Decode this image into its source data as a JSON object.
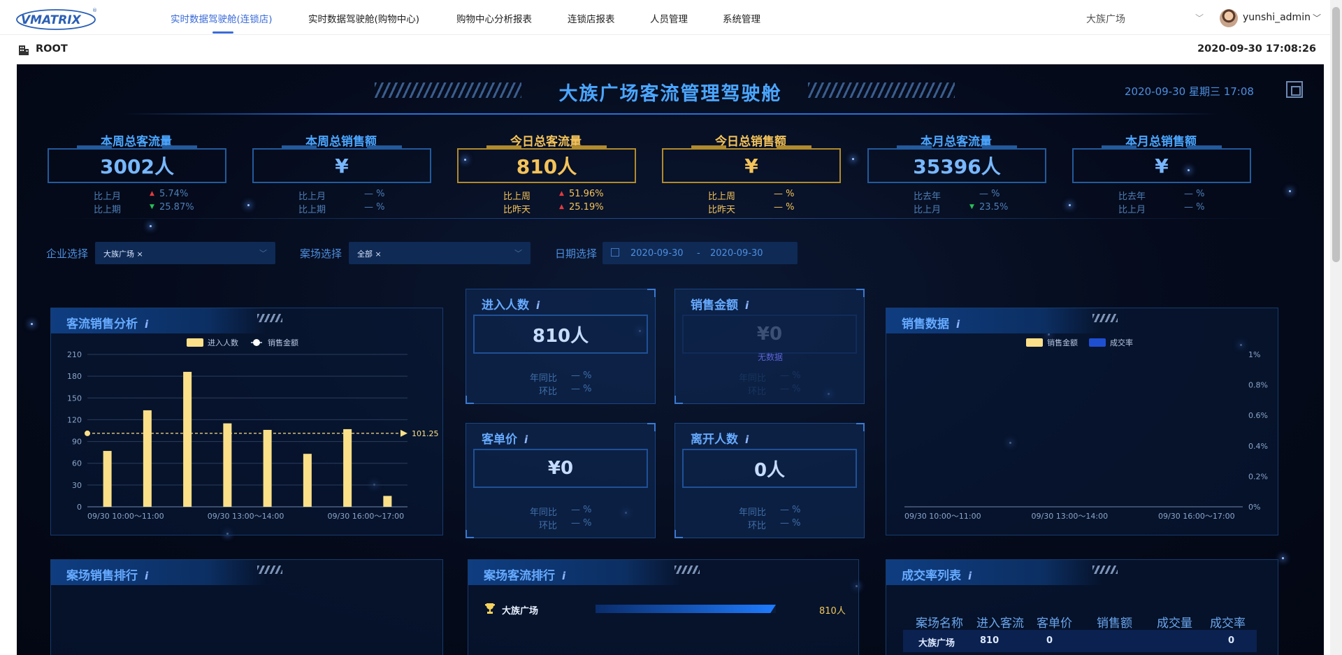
{
  "brand": {
    "logo_text": "VMATRIX",
    "registered_mark": "®"
  },
  "nav": {
    "items": [
      {
        "label": "实时数据驾驶舱(连锁店)",
        "active": true
      },
      {
        "label": "实时数据驾驶舱(购物中心)",
        "active": false
      },
      {
        "label": "购物中心分析报表",
        "active": false
      },
      {
        "label": "连锁店报表",
        "active": false
      },
      {
        "label": "人员管理",
        "active": false
      },
      {
        "label": "系统管理",
        "active": false
      }
    ],
    "store_select": "大族广场",
    "user_name": "yunshi_admin",
    "accent_color": "#3a6bd8"
  },
  "breadcrumb": {
    "root": "ROOT",
    "datetime": "2020-09-30 17:08:26"
  },
  "dashboard": {
    "title": "大族广场客流管理驾驶舱",
    "date_text": "2020-09-30 星期三 17:08",
    "kpis": [
      {
        "title": "本周总客流量",
        "value": "3002人",
        "theme": "blue",
        "rows": [
          {
            "label": "比上月",
            "arrow": "up",
            "value": "5.74%"
          },
          {
            "label": "比上期",
            "arrow": "down",
            "value": "25.87%"
          }
        ]
      },
      {
        "title": "本周总销售额",
        "value": "¥",
        "theme": "blue",
        "rows": [
          {
            "label": "比上月",
            "arrow": "none",
            "value": "— %"
          },
          {
            "label": "比上期",
            "arrow": "none",
            "value": "— %"
          }
        ]
      },
      {
        "title": "今日总客流量",
        "value": "810人",
        "theme": "gold",
        "rows": [
          {
            "label": "比上周",
            "arrow": "up",
            "value": "51.96%"
          },
          {
            "label": "比昨天",
            "arrow": "up",
            "value": "25.19%"
          }
        ]
      },
      {
        "title": "今日总销售额",
        "value": "¥",
        "theme": "gold",
        "rows": [
          {
            "label": "比上周",
            "arrow": "none",
            "value": "— %"
          },
          {
            "label": "比昨天",
            "arrow": "none",
            "value": "— %"
          }
        ]
      },
      {
        "title": "本月总客流量",
        "value": "35396人",
        "theme": "blue",
        "rows": [
          {
            "label": "比去年",
            "arrow": "none",
            "value": "— %"
          },
          {
            "label": "比上月",
            "arrow": "down",
            "value": "23.5%"
          }
        ]
      },
      {
        "title": "本月总销售额",
        "value": "¥",
        "theme": "blue",
        "rows": [
          {
            "label": "比去年",
            "arrow": "none",
            "value": "— %"
          },
          {
            "label": "比上月",
            "arrow": "none",
            "value": "— %"
          }
        ]
      }
    ],
    "arrows": {
      "up": "▲",
      "down": "▼"
    },
    "filters": {
      "enterprise_label": "企业选择",
      "enterprise_tag": "大族广场 ×",
      "venue_label": "案场选择",
      "venue_tag": "全部 ×",
      "date_label": "日期选择",
      "date_start": "2020-09-30",
      "date_sep": "-",
      "date_end": "2020-09-30"
    },
    "traffic_sales_panel": {
      "title": "客流销售分析",
      "legend_traffic": "进入人数",
      "legend_sales": "销售金额"
    },
    "entries_card": {
      "title": "进入人数",
      "value": "810人",
      "yoy_label": "年同比",
      "yoy": "— %",
      "mom_label": "环比",
      "mom": "— %"
    },
    "sales_card": {
      "title": "销售金额",
      "value": "¥0",
      "nodata": "无数据",
      "yoy_label": "年同比",
      "yoy": "— %",
      "mom_label": "环比",
      "mom": "— %"
    },
    "unit_price_card": {
      "title": "客单价",
      "value": "¥0",
      "yoy_label": "年同比",
      "yoy": "— %",
      "mom_label": "环比",
      "mom": "— %"
    },
    "exits_card": {
      "title": "离开人数",
      "value": "0人",
      "yoy_label": "年同比",
      "yoy": "— %",
      "mom_label": "环比",
      "mom": "— %"
    },
    "sales_data_panel": {
      "title": "销售数据",
      "legend_sales": "销售金额",
      "legend_rate": "成交率"
    },
    "venue_sales_rank": {
      "title": "案场销售排行"
    },
    "venue_traffic_rank": {
      "title": "案场客流排行",
      "rows": [
        {
          "name": "大族广场",
          "value": "810人",
          "fill": 1.0
        }
      ]
    },
    "conversion_table": {
      "title": "成交率列表",
      "columns": [
        "案场名称",
        "进入客流",
        "客单价",
        "销售额",
        "成交量",
        "成交率"
      ],
      "rows": [
        [
          "大族广场",
          "810",
          "0",
          "",
          "",
          "0"
        ]
      ]
    }
  },
  "chart_data": [
    {
      "type": "bar",
      "title": "客流销售分析",
      "categories": [
        "09/30 10:00～11:00",
        "",
        "09/30 13:00～14:00",
        "",
        "",
        "09/30 16:00～17:00",
        "",
        ""
      ],
      "series": [
        {
          "name": "进入人数",
          "values": [
            77,
            133,
            186,
            115,
            106,
            73,
            107,
            15
          ]
        }
      ],
      "average_line": {
        "value": 101.25,
        "label": "101.25"
      },
      "y_ticks": [
        "0",
        "30",
        "60",
        "90",
        "120",
        "150",
        "180",
        "210"
      ],
      "ylim": [
        0,
        210
      ],
      "x_tick_labels": [
        "09/30 10:00～11:00",
        "09/30 13:00～14:00",
        "09/30 16:00～17:00"
      ],
      "colors": {
        "bar": "#fbe089",
        "avg_line": "#fbe089"
      },
      "legend": [
        "进入人数",
        "销售金额"
      ],
      "legend_position": "top-center"
    },
    {
      "type": "bar",
      "title": "销售数据",
      "series": [
        {
          "name": "销售金额",
          "values": []
        },
        {
          "name": "成交率",
          "values": []
        }
      ],
      "y_right_ticks": [
        "0%",
        "0.2%",
        "0.4%",
        "0.6%",
        "0.8%",
        "1%"
      ],
      "x_tick_labels": [
        "09/30 10:00～11:00",
        "09/30 13:00～14:00",
        "09/30 16:00～17:00"
      ],
      "colors": {
        "sales": "#fbe089",
        "rate": "#1f4fd1"
      },
      "legend_position": "top-center"
    }
  ]
}
